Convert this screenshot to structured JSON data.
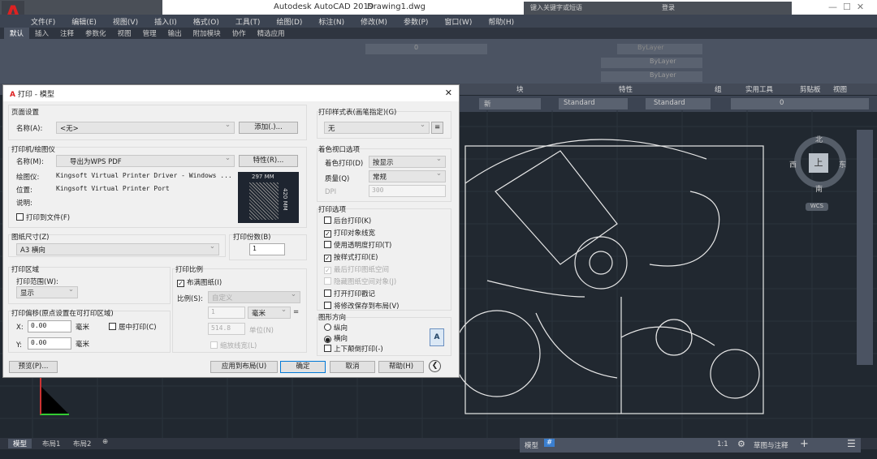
{
  "app": {
    "title": "Autodesk AutoCAD 2019",
    "file": "Drawing1.dwg",
    "search_placeholder": "键入关键字或短语",
    "login": "登录"
  },
  "menu": [
    "文件(F)",
    "编辑(E)",
    "视图(V)",
    "插入(I)",
    "格式(O)",
    "工具(T)",
    "绘图(D)",
    "标注(N)",
    "修改(M)",
    "参数(P)",
    "窗口(W)",
    "帮助(H)"
  ],
  "ribbon_tabs": [
    "默认",
    "插入",
    "注释",
    "参数化",
    "视图",
    "管理",
    "输出",
    "附加模块",
    "协作",
    "精选应用"
  ],
  "panels": [
    "块",
    "特性",
    "组",
    "实用工具",
    "剪贴板",
    "视图"
  ],
  "properties": {
    "color": "ByLayer",
    "linetype": "ByLayer",
    "lineweight": "ByLayer",
    "layer": "0"
  },
  "toolbar2": {
    "new": "新",
    "textstyle": "Standard",
    "dimstyle": "Standard",
    "layer": "0"
  },
  "dialog": {
    "title": "打印 - 模型",
    "page_setup": {
      "label": "页面设置",
      "name_label": "名称(A):",
      "name_value": "<无>",
      "add_button": "添加(.)..."
    },
    "printer": {
      "label": "打印机/绘图仪",
      "name_label": "名称(M):",
      "name_value": "导出为WPS PDF",
      "props_button": "特性(R)...",
      "plotter_label": "绘图仪:",
      "plotter_value": "Kingsoft Virtual Printer Driver - Windows ...",
      "location_label": "位置:",
      "location_value": "Kingsoft Virtual Printer Port",
      "desc_label": "说明:",
      "print_to_file": "打印到文件(F)",
      "preview_width": "297 MM",
      "preview_height": "420 MM"
    },
    "paper_size": {
      "label": "图纸尺寸(Z)",
      "value": "A3 横向"
    },
    "copies": {
      "label": "打印份数(B)",
      "value": "1"
    },
    "area": {
      "label": "打印区域",
      "range_label": "打印范围(W):",
      "range_value": "显示"
    },
    "offset": {
      "label": "打印偏移(原点设置在可打印区域)",
      "x_label": "X:",
      "x_value": "0.00",
      "y_label": "Y:",
      "y_value": "0.00",
      "unit": "毫米",
      "center": "居中打印(C)"
    },
    "scale": {
      "label": "打印比例",
      "fit": "布满图纸(I)",
      "scale_label": "比例(S):",
      "scale_value": "自定义",
      "num": "1",
      "unit": "毫米",
      "eq": "=",
      "den": "514.8",
      "den_unit": "单位(N)",
      "lw": "缩放线宽(L)"
    },
    "style_table": {
      "label": "打印样式表(画笔指定)(G)",
      "value": "无"
    },
    "shaded": {
      "label": "着色视口选项",
      "shade_label": "着色打印(D)",
      "shade_value": "按显示",
      "quality_label": "质量(Q)",
      "quality_value": "常规",
      "dpi_label": "DPI",
      "dpi_value": "300"
    },
    "options": {
      "label": "打印选项",
      "items": [
        {
          "t": "后台打印(K)",
          "c": false,
          "d": false
        },
        {
          "t": "打印对象线宽",
          "c": true,
          "d": false
        },
        {
          "t": "使用透明度打印(T)",
          "c": false,
          "d": false
        },
        {
          "t": "按样式打印(E)",
          "c": true,
          "d": false
        },
        {
          "t": "最后打印图纸空间",
          "c": true,
          "d": true
        },
        {
          "t": "隐藏图纸空间对象(J)",
          "c": false,
          "d": true
        },
        {
          "t": "打开打印戳记",
          "c": false,
          "d": false
        },
        {
          "t": "将修改保存到布局(V)",
          "c": false,
          "d": false
        }
      ]
    },
    "orientation": {
      "label": "图形方向",
      "portrait": "纵向",
      "landscape": "横向",
      "upside": "上下颠倒打印(-)"
    },
    "buttons": {
      "preview": "预览(P)...",
      "apply": "应用到布局(U)",
      "ok": "确定",
      "cancel": "取消",
      "help": "帮助(H)"
    }
  },
  "viewcube": {
    "n": "北",
    "s": "南",
    "e": "东",
    "w": "西",
    "top": "上",
    "wcs": "WCS"
  },
  "layout_tabs": [
    "模型",
    "布局1",
    "布局2"
  ],
  "status": {
    "model": "模型",
    "scale": "1:1",
    "workspace": "草图与注释"
  }
}
